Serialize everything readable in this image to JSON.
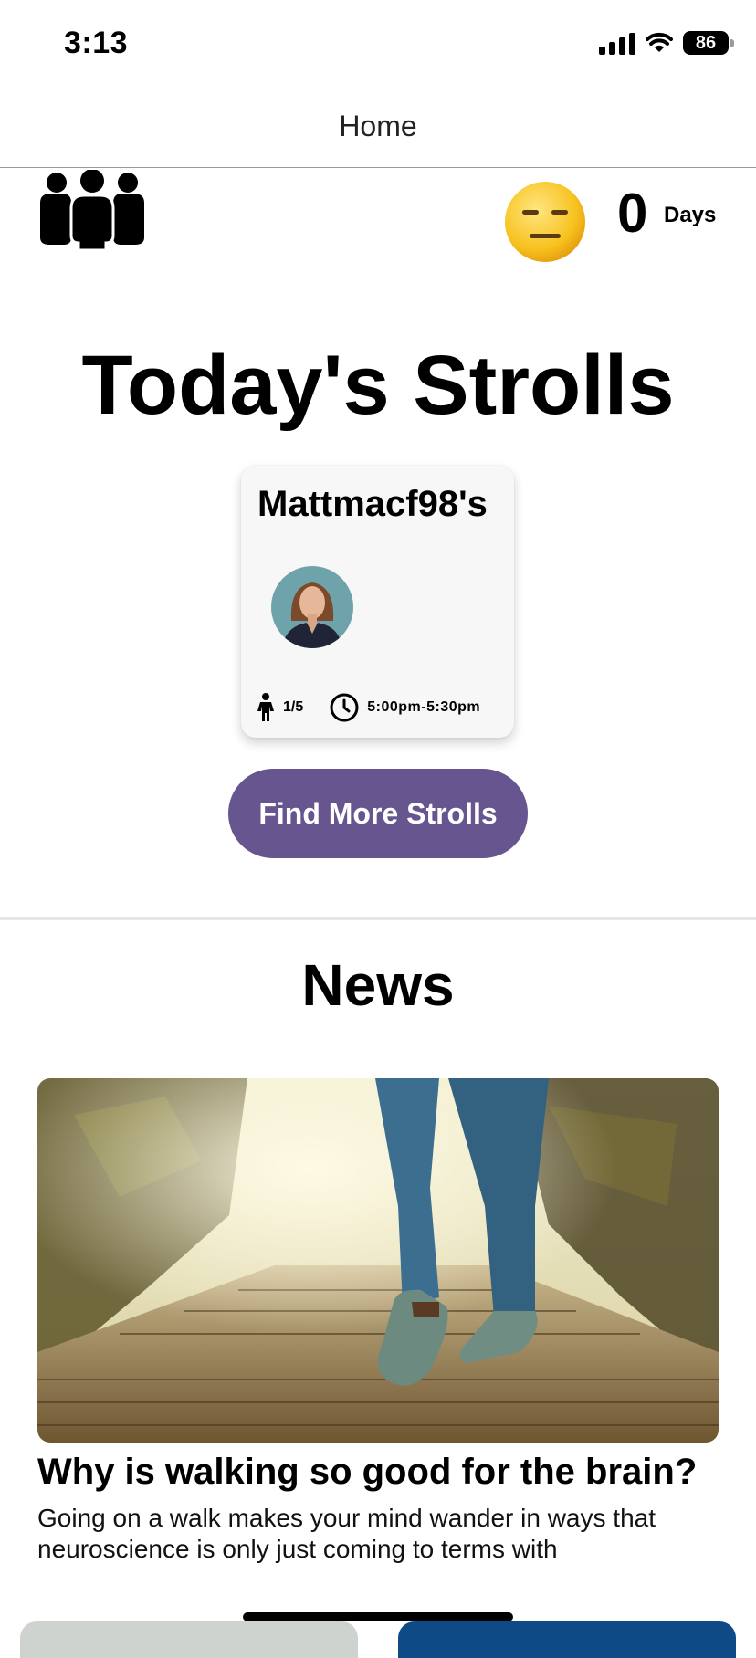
{
  "status_bar": {
    "time": "3:13",
    "battery": "86"
  },
  "nav": {
    "title": "Home"
  },
  "header": {
    "streak_count": "0",
    "streak_label": "Days",
    "mood_icon": "expressionless-face-icon",
    "group_icon": "group-people-icon"
  },
  "strolls": {
    "title": "Today's Strolls",
    "cards": [
      {
        "title": "Mattmacf98's",
        "participants": "1/5",
        "time": "5:00pm-5:30pm"
      }
    ],
    "find_more_label": "Find More Strolls"
  },
  "news": {
    "title": "News",
    "articles": [
      {
        "headline": "Why is walking so good for the brain?",
        "summary": "Going on a walk makes your mind wander in ways that neuroscience is only just coming to terms with"
      }
    ]
  },
  "colors": {
    "accent": "#66558f",
    "emoji_yellow": "#f7c21f"
  }
}
